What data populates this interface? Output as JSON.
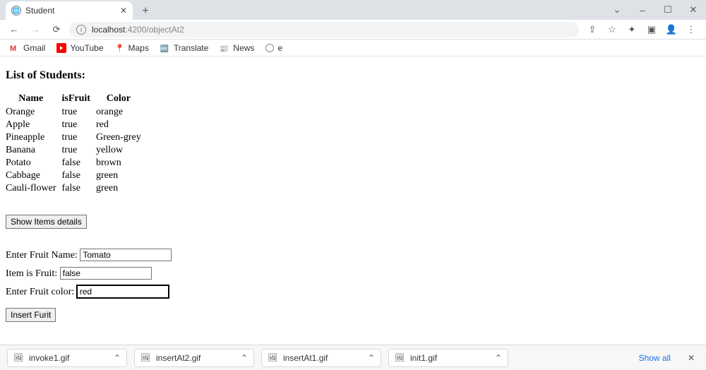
{
  "window": {
    "tab_title": "Student",
    "minimize": "–",
    "maximize": "☐",
    "close": "✕"
  },
  "toolbar": {
    "address_host": "localhost",
    "address_port": ":4200",
    "address_path": "/objectAt2"
  },
  "bookmarks": {
    "gmail": "Gmail",
    "youtube": "YouTube",
    "maps": "Maps",
    "translate": "Translate",
    "news": "News",
    "e": "e"
  },
  "page": {
    "heading": "List of Students:",
    "columns": {
      "name": "Name",
      "isFruit": "isFruit",
      "color": "Color"
    },
    "rows": [
      {
        "name": "Orange",
        "isFruit": "true",
        "color": "orange"
      },
      {
        "name": "Apple",
        "isFruit": "true",
        "color": "red"
      },
      {
        "name": "Pineapple",
        "isFruit": "true",
        "color": "Green-grey"
      },
      {
        "name": "Banana",
        "isFruit": "true",
        "color": "yellow"
      },
      {
        "name": "Potato",
        "isFruit": "false",
        "color": "brown"
      },
      {
        "name": "Cabbage",
        "isFruit": "false",
        "color": "green"
      },
      {
        "name": "Cauli-flower",
        "isFruit": "false",
        "color": "green"
      }
    ],
    "show_details_label": "Show Items details",
    "labels": {
      "fruit_name": "Enter Fruit Name: ",
      "is_fruit": "Item is Fruit: ",
      "fruit_color": "Enter Fruit color: "
    },
    "inputs": {
      "fruit_name": "Tomato",
      "is_fruit": "false",
      "fruit_color": "red"
    },
    "insert_label": "Insert Furit"
  },
  "downloads": {
    "items": [
      "invoke1.gif",
      "insertAt2.gif",
      "insertAt1.gif",
      "init1.gif"
    ],
    "show_all": "Show all"
  }
}
